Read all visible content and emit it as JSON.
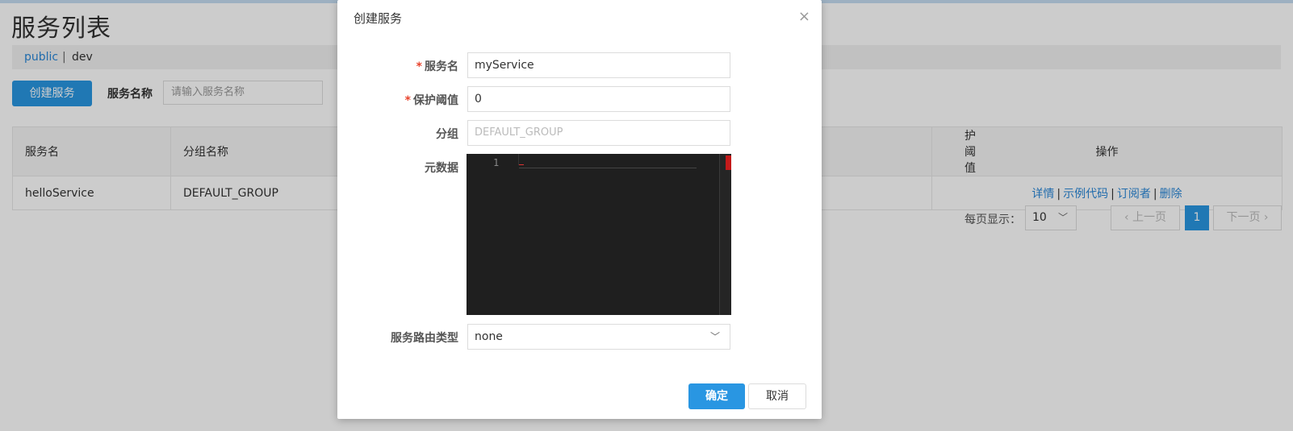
{
  "page": {
    "title": "服务列表",
    "namespaces": [
      "public",
      "dev"
    ],
    "namespace_separator": "|",
    "create_button": "创建服务",
    "filter_label": "服务名称",
    "filter_placeholder": "请输入服务名称"
  },
  "table": {
    "headers": [
      "服务名",
      "分组名称",
      "护阈值",
      "操作"
    ],
    "rows": [
      {
        "service_name": "helloService",
        "group_name": "DEFAULT_GROUP",
        "threshold": ""
      }
    ],
    "operations": [
      "详情",
      "示例代码",
      "订阅者",
      "删除"
    ],
    "operation_separator": "|"
  },
  "pagination": {
    "page_size_label": "每页显示：",
    "page_size": "10",
    "prev_label": "上一页",
    "current_page": "1",
    "next_label": "下一页"
  },
  "dialog": {
    "title": "创建服务",
    "close_glyph": "×",
    "required_mark": "*",
    "fields": {
      "service_name": {
        "label": "服务名",
        "value": "myService"
      },
      "protect_threshold": {
        "label": "保护阈值",
        "value": "0"
      },
      "group": {
        "label": "分组",
        "placeholder": "DEFAULT_GROUP"
      },
      "metadata": {
        "label": "元数据",
        "line_number": "1"
      },
      "selector_type": {
        "label": "服务路由类型",
        "value": "none"
      }
    },
    "ok_button": "确定",
    "cancel_button": "取消"
  },
  "icons": {
    "chevron_down": "﹀",
    "chevron_left": "‹",
    "chevron_right": "›"
  },
  "colors": {
    "accent": "#2996e2",
    "link": "#2a87d8",
    "required": "#e8432c",
    "editor_bg": "#1f1f1f"
  }
}
